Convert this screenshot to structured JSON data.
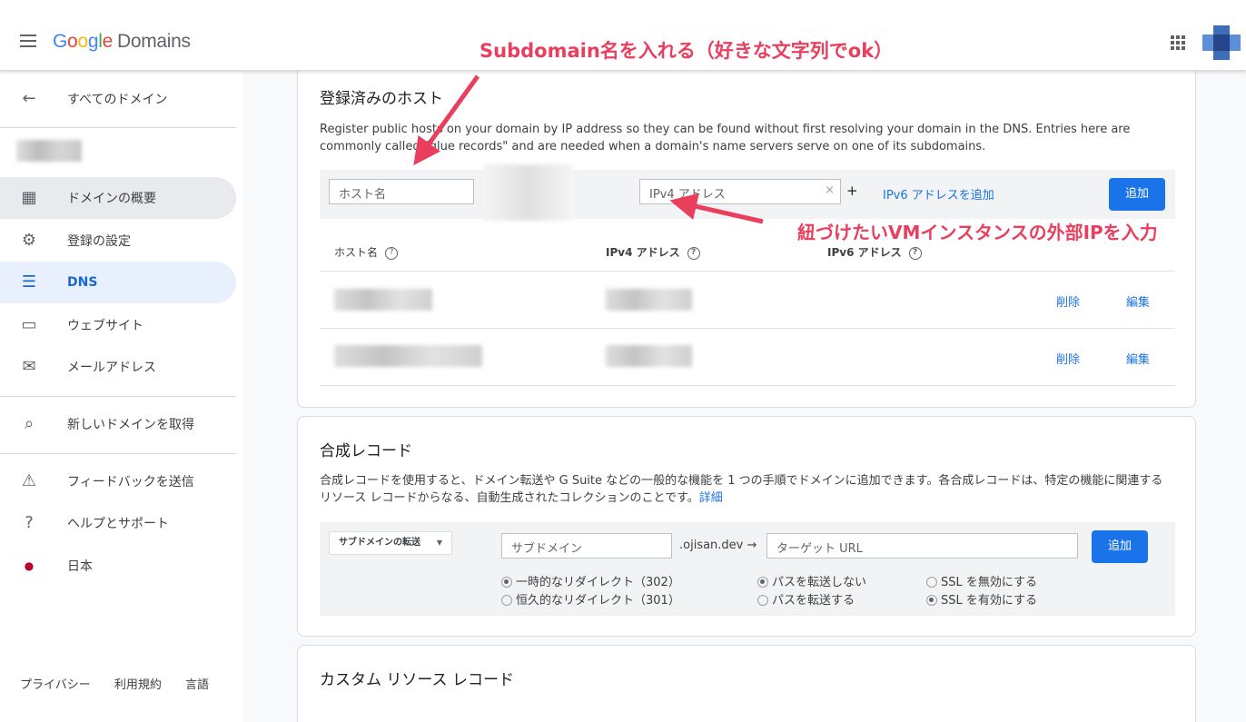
{
  "app": {
    "logo_google": "Google",
    "logo_domains": "Domains"
  },
  "sidebar": {
    "back_label": "すべてのドメイン",
    "items": [
      {
        "label": "ドメインの概要",
        "icon": "dashboard-icon"
      },
      {
        "label": "登録の設定",
        "icon": "gear-icon"
      },
      {
        "label": "DNS",
        "icon": "dns-icon"
      },
      {
        "label": "ウェブサイト",
        "icon": "website-icon"
      },
      {
        "label": "メールアドレス",
        "icon": "mail-icon"
      }
    ],
    "get_domain": "新しいドメインを取得",
    "feedback": "フィードバックを送信",
    "help": "ヘルプとサポート",
    "country": "日本",
    "footer": [
      "プライバシー",
      "利用規約",
      "言語"
    ]
  },
  "hosts": {
    "title": "登録済みのホスト",
    "desc": "Register public hosts on your domain by IP address so they can be found without first resolving your domain in the DNS. Entries here are commonly called \"glue records\" and are needed when a domain's name servers serve on one of its subdomains.",
    "host_placeholder": "ホスト名",
    "ipv4_placeholder": "IPv4 アドレス",
    "clear": "×",
    "plus": "+",
    "add_ipv6": "IPv6 アドレスを追加",
    "add_button": "追加",
    "col_host": "ホスト名",
    "col_ipv4": "IPv4 アドレス",
    "col_ipv6": "IPv6 アドレス",
    "delete": "削除",
    "edit": "編集"
  },
  "synthetic": {
    "title": "合成レコード",
    "desc": "合成レコードを使用すると、ドメイン転送や G Suite などの一般的な機能を 1 つの手順でドメインに追加できます。各合成レコードは、特定の機能に関連するリソース レコードからなる、自動生成されたコレクションのことです。",
    "more": "詳細",
    "type_select": "サブドメインの転送",
    "subdomain_placeholder": "サブドメイン",
    "domain_suffix": ".ojisan.dev →",
    "target_placeholder": "ターゲット URL",
    "add_button": "追加",
    "redirect_temp": "一時的なリダイレクト（302）",
    "redirect_perm": "恒久的なリダイレクト（301）",
    "path_no": "パスを転送しない",
    "path_yes": "パスを転送する",
    "ssl_off": "SSL を無効にする",
    "ssl_on": "SSL を有効にする"
  },
  "custom": {
    "title": "カスタム リソース レコード"
  },
  "annotations": {
    "top": "Subdomain名を入れる（好きな文字列でok）",
    "right": "紐づけたいVMインスタンスの外部IPを入力"
  },
  "colors": {
    "accent": "#1a73e8",
    "annotation": "#ea3e5e"
  }
}
